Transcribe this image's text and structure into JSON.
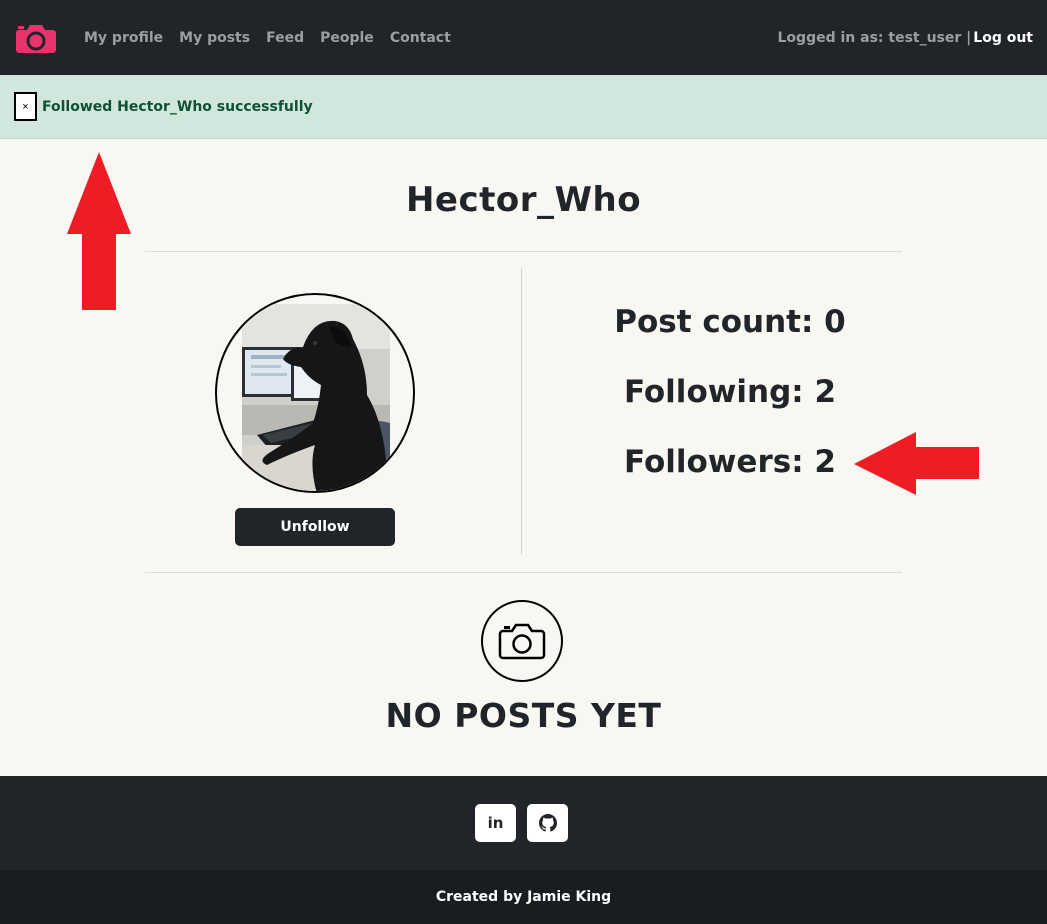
{
  "navbar": {
    "brand_icon": "camera-icon",
    "brand_color": "#e8336d",
    "links": [
      "My profile",
      "My posts",
      "Feed",
      "People",
      "Contact"
    ],
    "logged_in_text": "Logged in as: test_user |",
    "logout_label": "Log out"
  },
  "alert": {
    "close_symbol": "×",
    "message": "Followed Hector_Who successfully"
  },
  "profile": {
    "username": "Hector_Who",
    "unfollow_label": "Unfollow",
    "post_count": "Post count: 0",
    "following": "Following: 2",
    "followers": "Followers: 2"
  },
  "posts": {
    "empty_icon": "camera-icon",
    "empty_text": "NO POSTS YET"
  },
  "footer": {
    "linkedin_label": "in",
    "github_icon": "github-icon",
    "credit": "Created by Jamie King"
  },
  "colors": {
    "navbar_bg": "#212529",
    "alert_bg": "#d1e7dd",
    "alert_text": "#0f5132",
    "annotation_arrow": "#ee1c25"
  }
}
